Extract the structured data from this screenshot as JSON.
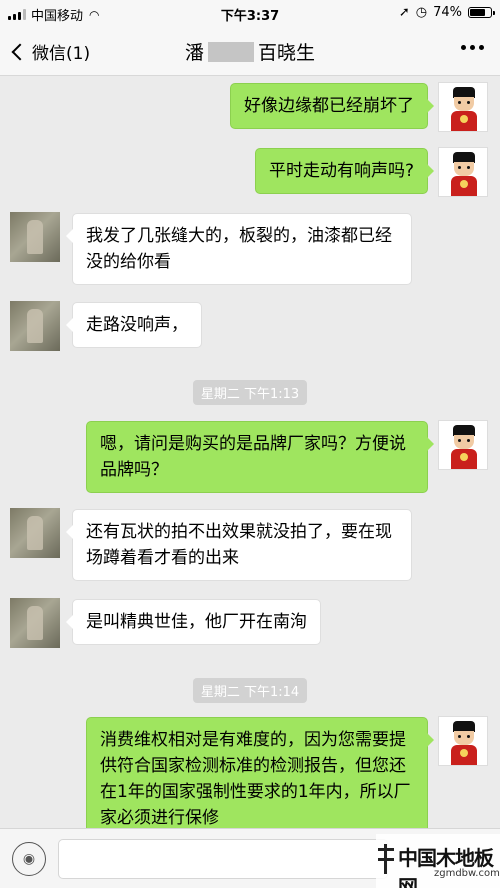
{
  "status_bar": {
    "carrier": "中国移动",
    "time": "下午3:37",
    "battery": "74%",
    "battery_level": 0.74
  },
  "nav": {
    "back_label": "微信(1)",
    "title_prefix": "潘",
    "title_suffix": "百晓生"
  },
  "messages": [
    {
      "from": "me",
      "text": "好像边缘都已经崩坏了"
    },
    {
      "from": "me",
      "text": "平时走动有响声吗?"
    },
    {
      "from": "them",
      "text": "我发了几张缝大的，板裂的，油漆都已经没的给你看"
    },
    {
      "from": "them",
      "text": "走路没响声，"
    },
    {
      "from": "system",
      "text": "星期二 下午1:13"
    },
    {
      "from": "me",
      "text": "嗯，请问是购买的是品牌厂家吗？方便说品牌吗？"
    },
    {
      "from": "them",
      "text": "还有瓦状的拍不出效果就没拍了，要在现场蹲着看才看的出来"
    },
    {
      "from": "them",
      "text": "是叫精典世佳，他厂开在南洵"
    },
    {
      "from": "system",
      "text": "星期二 下午1:14"
    },
    {
      "from": "me",
      "text": "消费维权相对是有难度的，因为您需要提供符合国家检测标准的检测报告，但您还在1年的国家强制性要求的1年内，所以厂家必须进行保修"
    }
  ],
  "watermark": {
    "name": "中国木地板网",
    "url": "zgmdbw.com"
  }
}
